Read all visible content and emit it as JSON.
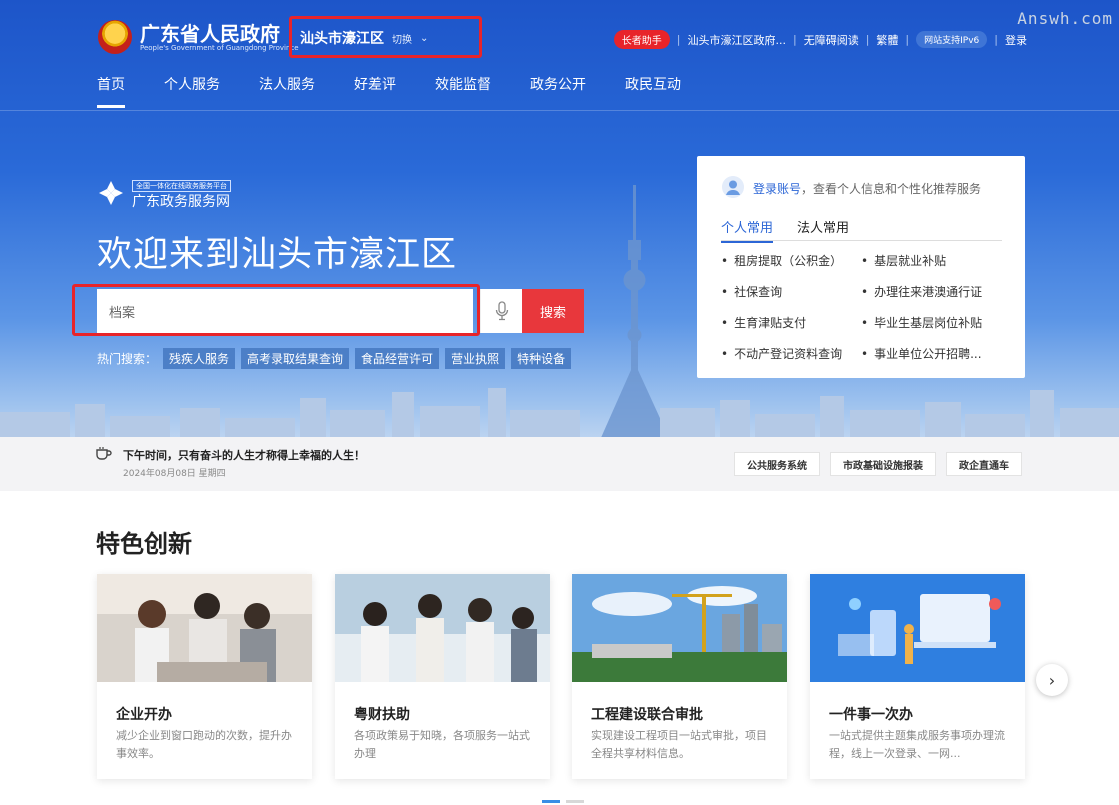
{
  "watermark": "Answh.com",
  "header": {
    "logo_title": "广东省人民政府",
    "logo_subtitle": "People's Government of Guangdong Province",
    "region": "汕头市濠江区",
    "switch_label": "切换",
    "top_links": [
      "长者助手",
      "汕头市濠江区政府...",
      "无障碍阅读",
      "繁體",
      "网站支持IPv6",
      "登录"
    ],
    "nav": [
      "首页",
      "个人服务",
      "法人服务",
      "好差评",
      "效能监督",
      "政务公开",
      "政民互动"
    ]
  },
  "service_platform": {
    "tag": "全国一体化在线政务服务平台",
    "name": "广东政务服务网"
  },
  "welcome": "欢迎来到汕头市濠江区",
  "search": {
    "value": "档案",
    "button": "搜索",
    "hot_label": "热门搜索：",
    "hot": [
      "残疾人服务",
      "高考录取结果查询",
      "食品经营许可",
      "营业执照",
      "特种设备"
    ]
  },
  "login_card": {
    "link": "登录账号",
    "text": "，查看个人信息和个性化推荐服务",
    "tabs": [
      "个人常用",
      "法人常用"
    ],
    "items": [
      "租房提取（公积金）",
      "基层就业补贴",
      "社保查询",
      "办理往来港澳通行证",
      "生育津贴支付",
      "毕业生基层岗位补贴",
      "不动产登记资料查询",
      "事业单位公开招聘..."
    ]
  },
  "tip": {
    "text": "下午时间，只有奋斗的人生才称得上幸福的人生！",
    "date": "2024年08月08日 星期四"
  },
  "quick_links": [
    "公共服务系统",
    "市政基础设施报装",
    "政企直通车"
  ],
  "section_title": "特色创新",
  "cards": [
    {
      "title": "企业开办",
      "desc": "减少企业到窗口跑动的次数，提升办事效率。"
    },
    {
      "title": "粤财扶助",
      "desc": "各项政策易于知晓，各项服务一站式办理"
    },
    {
      "title": "工程建设联合审批",
      "desc": "实现建设工程项目一站式审批，项目全程共享材料信息。"
    },
    {
      "title": "一件事一次办",
      "desc": "一站式提供主题集成服务事项办理流程，线上一次登录、一网..."
    }
  ],
  "colors": {
    "brand_blue": "#2c66d6",
    "accent_red": "#e8373c"
  }
}
